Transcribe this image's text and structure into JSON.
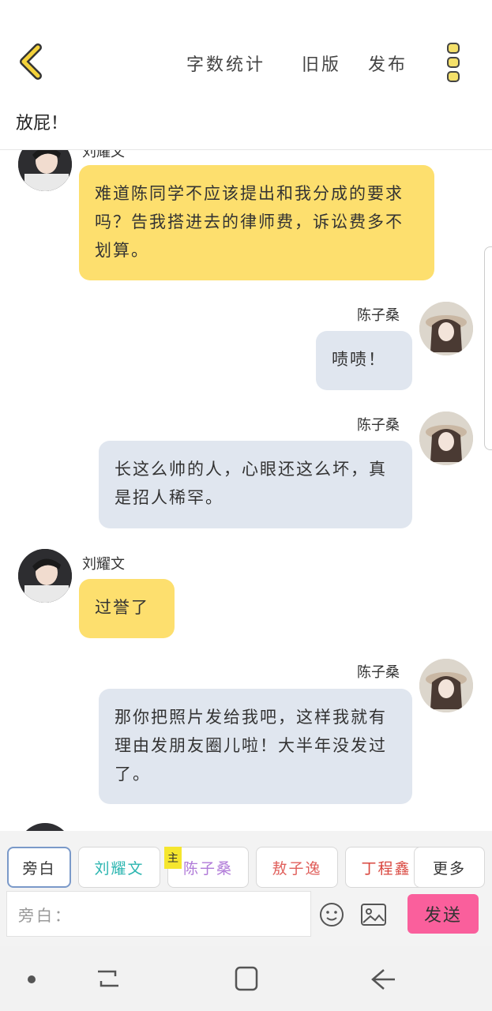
{
  "header": {
    "word_count": "字数统计",
    "old_version": "旧版",
    "publish": "发布"
  },
  "title": "放屁！",
  "messages": [
    {
      "side": "left",
      "name": "刘耀文",
      "text": "难道陈同学不应该提出和我分成的要求吗？告我搭进去的律师费，诉讼费多不划算。"
    },
    {
      "side": "right",
      "name": "陈子桑",
      "text": "啧啧！"
    },
    {
      "side": "right",
      "name": "陈子桑",
      "text": "长这么帅的人，心眼还这么坏，真是招人稀罕。"
    },
    {
      "side": "left",
      "name": "刘耀文",
      "text": "过誉了"
    },
    {
      "side": "right",
      "name": "陈子桑",
      "text": "那你把照片发给我吧，这样我就有理由发朋友圈儿啦！大半年没发过了。"
    }
  ],
  "roles": {
    "narration": "旁白",
    "liu": "刘耀文",
    "chen": "陈子桑",
    "shu": "敖子逸",
    "ding": "丁程鑫",
    "more": "更多",
    "master_tag": "主"
  },
  "input": {
    "value": "旁白："
  },
  "send_label": "发送",
  "colors": {
    "accent_yellow": "#fddf6e",
    "bubble_gray": "#e0e6ef",
    "send_pink": "#fa5f9c",
    "role_liu": "#2bb5b0",
    "role_chen": "#b07ad8",
    "role_shu": "#e0605c",
    "role_ding": "#d9473f"
  }
}
